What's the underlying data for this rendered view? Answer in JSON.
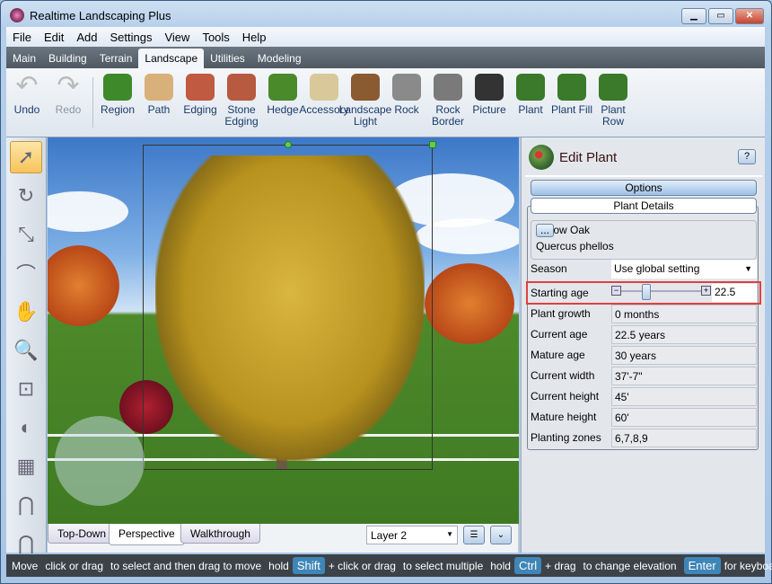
{
  "window": {
    "title": "Realtime Landscaping Plus",
    "controls": [
      "minimize",
      "maximize",
      "close"
    ]
  },
  "menu": [
    "File",
    "Edit",
    "Add",
    "Settings",
    "View",
    "Tools",
    "Help"
  ],
  "tabs": [
    {
      "label": "Main"
    },
    {
      "label": "Building"
    },
    {
      "label": "Terrain"
    },
    {
      "label": "Landscape",
      "active": true
    },
    {
      "label": "Utilities"
    },
    {
      "label": "Modeling"
    }
  ],
  "ribbon": {
    "history": [
      {
        "label": "Undo",
        "icon": "undo-icon"
      },
      {
        "label": "Redo",
        "icon": "redo-icon",
        "disabled": true
      }
    ],
    "tools": [
      {
        "label": "Region",
        "icon": "region-icon",
        "color": "#3e8a2a"
      },
      {
        "label": "Path",
        "icon": "path-icon",
        "color": "#d8b07a"
      },
      {
        "label": "Edging",
        "icon": "edging-icon",
        "color": "#c05a40"
      },
      {
        "label": "Stone Edging",
        "icon": "stone-edging-icon",
        "color": "#b85a40"
      },
      {
        "label": "Hedge",
        "icon": "hedge-icon",
        "color": "#4a8a2a"
      },
      {
        "label": "Accessory",
        "icon": "accessory-icon",
        "color": "#d8c89a"
      },
      {
        "label": "Landscape Light",
        "icon": "landscape-light-icon",
        "color": "#8a5a30"
      },
      {
        "label": "Rock",
        "icon": "rock-icon",
        "color": "#8a8a8a"
      },
      {
        "label": "Rock Border",
        "icon": "rock-border-icon",
        "color": "#7a7a7a"
      },
      {
        "label": "Picture",
        "icon": "camera-icon",
        "color": "#333333"
      },
      {
        "label": "Plant",
        "icon": "plant-icon",
        "color": "#3a7a2a"
      },
      {
        "label": "Plant Fill",
        "icon": "plant-fill-icon",
        "color": "#3a7a2a"
      },
      {
        "label": "Plant Row",
        "icon": "plant-row-icon",
        "color": "#3a7a2a"
      }
    ]
  },
  "left_tools": [
    "select-arrow-icon",
    "rotate-icon",
    "resize-icon",
    "curve-icon",
    "pan-hand-icon",
    "zoom-icon",
    "zoom-extents-icon",
    "orbit-icon",
    "grid-icon",
    "magnet-icon",
    "magnet-small-icon"
  ],
  "view_tabs": [
    {
      "label": "Top-Down"
    },
    {
      "label": "Perspective",
      "active": true
    },
    {
      "label": "Walkthrough"
    }
  ],
  "layer": {
    "selected": "Layer 2"
  },
  "panel": {
    "title": "Edit Plant",
    "help": "?",
    "options_label": "Options",
    "details_label": "Plant Details",
    "common_name": "Willow Oak",
    "botanical_name": "Quercus phellos",
    "browse_label": "...",
    "season": {
      "label": "Season",
      "value": "Use global setting"
    },
    "starting_age": {
      "label": "Starting age",
      "value": "22.5",
      "slider_fraction": 0.4
    },
    "fields": [
      {
        "label": "Plant growth",
        "value": "0 months"
      },
      {
        "label": "Current age",
        "value": "22.5 years"
      },
      {
        "label": "Mature age",
        "value": "30 years"
      },
      {
        "label": "Current width",
        "value": "37'-7\""
      },
      {
        "label": "Current height",
        "value": "45'"
      },
      {
        "label": "Mature height",
        "value": "60'"
      },
      {
        "label": "Planting zones",
        "value": "6,7,8,9"
      }
    ]
  },
  "status": {
    "mode": "Move",
    "t1": "click or drag",
    "t2": "to select and then drag to move",
    "t3": "hold",
    "k1": "Shift",
    "t4": "+ click or drag",
    "t5": "to select multiple",
    "t6": "hold",
    "k2": "Ctrl",
    "t7": "+ drag",
    "t8": "to change elevation",
    "k3": "Enter",
    "t9": "for keyboard"
  }
}
